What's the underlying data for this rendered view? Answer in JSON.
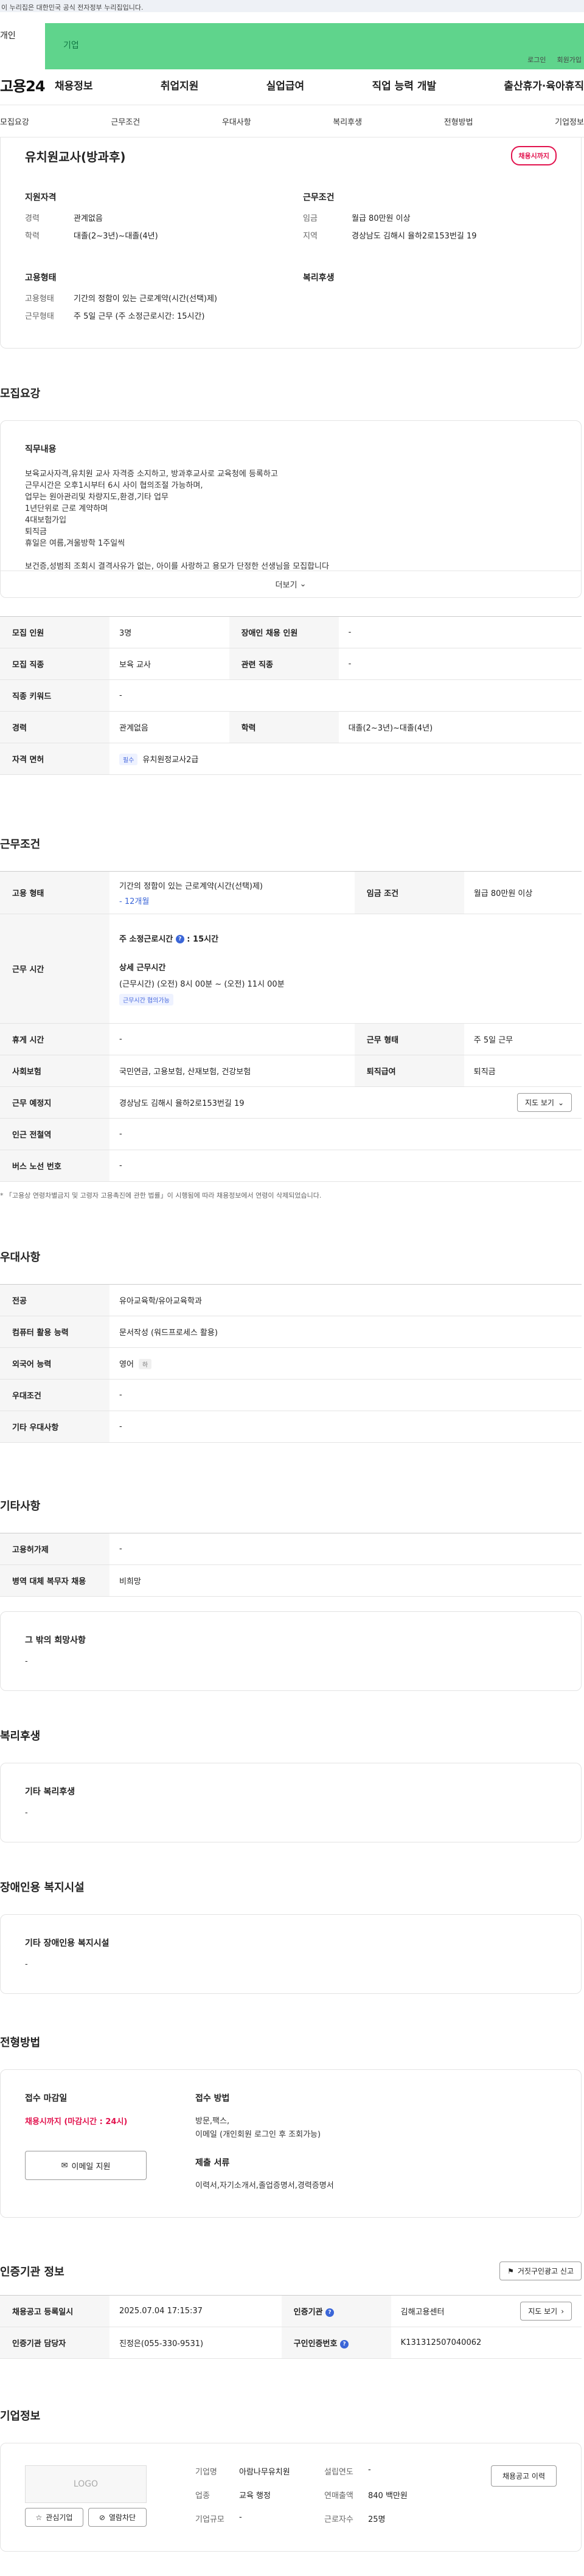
{
  "topbar": {
    "notice": "이 누리집은 대한민국 공식 전자정부 누리집입니다."
  },
  "member_tabs": {
    "personal": "개인",
    "company": "기업"
  },
  "util": {
    "login": "로그인",
    "join": "회원가입"
  },
  "header": {
    "logo": "고용24",
    "gnb": [
      "채용정보",
      "취업지원",
      "실업급여",
      "직업 능력 개발",
      "출산휴가·육아휴직"
    ]
  },
  "lnb": [
    "모집요강",
    "근무조건",
    "우대사항",
    "복리후생",
    "전형방법",
    "기업정보"
  ],
  "job": {
    "title": "유치원교사(방과후)",
    "deadline_badge": "채용시까지",
    "summary": {
      "qual_h": "지원자격",
      "career_k": "경력",
      "career_v": "관계없음",
      "edu_k": "학력",
      "edu_v": "대졸(2~3년)~대졸(4년)",
      "cond_h": "근무조건",
      "wage_k": "임금",
      "wage_v": "월급 80만원 이상",
      "area_k": "지역",
      "area_v": "경상남도 김해시 율하2로153번길 19",
      "emp_h": "고용형태",
      "emptype_k": "고용형태",
      "emptype_v": "기간의 정함이 있는 근로계약(시간(선택)제)",
      "worktype_k": "근무형태",
      "worktype_v": "주 5일 근무 (주 소정근로시간: 15시간)",
      "welfare_h": "복리후생"
    }
  },
  "recruit": {
    "section_title": "모집요강",
    "content_h": "직무내용",
    "content": "보육교사자격,유치원 교사 자격증 소지하고, 방과후교사로 교육청에 등록하고\n근무시간은 오후1시부터 6시 사이 협의조절 가능하며,\n업무는 원아관리및 차량지도,환경,기타 업무\n1년단위로 근로 계약하며\n4대보험가입\n퇴직금\n휴일은 여름,겨울방학 1주일씩\n\n보건증,성범죄 조회시 결격사유가 없는, 아이를 사랑하고 용모가 단정한 선생님을 모집합니다",
    "more": "더보기",
    "table": {
      "count_k": "모집 인원",
      "count_v": "3명",
      "disabled_k": "장애인 채용 인원",
      "disabled_v": "-",
      "job_k": "모집 직종",
      "job_v": "보육 교사",
      "related_k": "관련 직종",
      "related_v": "-",
      "keyword_k": "직종 키워드",
      "keyword_v": "-",
      "career_k": "경력",
      "career_v": "관계없음",
      "edu_k": "학력",
      "edu_v": "대졸(2~3년)~대졸(4년)",
      "license_k": "자격 면허",
      "license_chip": "필수",
      "license_v": "유치원정교사2급"
    }
  },
  "work": {
    "section_title": "근무조건",
    "emptype_k": "고용 형태",
    "emptype_v": "기간의 정함이 있는 근로계약(시간(선택)제)",
    "emptype_sub": "- 12개월",
    "wage_k": "임금 조건",
    "wage_v": "월급 80만원 이상",
    "time_k": "근무 시간",
    "time_weekly_label": "주 소정근로시간",
    "time_weekly_v": "15시간",
    "time_detail_h": "상세 근무시간",
    "time_detail_v": "(근무시간) (오전) 8시 00분 ~ (오전) 11시 00분",
    "time_chip": "근무시간 협의가능",
    "rest_k": "휴게 시간",
    "rest_v": "-",
    "worktype_k": "근무 형태",
    "worktype_v": "주 5일 근무",
    "insurance_k": "사회보험",
    "insurance_v": "국민연금, 고용보험, 산재보험, 건강보험",
    "retire_k": "퇴직급여",
    "retire_v": "퇴직금",
    "place_k": "근무 예정지",
    "place_v": "경상남도 김해시 율하2로153번길 19",
    "map_btn": "지도 보기",
    "subway_k": "인근 전철역",
    "subway_v": "-",
    "bus_k": "버스 노선 번호",
    "bus_v": "-",
    "note": "* 「고용상 연령차별금지 및 고령자 고용촉진에 관한 법률」이 시행됨에 따라 채용정보에서 연령이 삭제되었습니다."
  },
  "prefer": {
    "section_title": "우대사항",
    "major_k": "전공",
    "major_v": "유아교육학/유아교육학과",
    "pc_k": "컴퓨터 활용 능력",
    "pc_v": "문서작성 (워드프로세스 활용)",
    "lang_k": "외국어 능력",
    "lang_v": "영어",
    "lang_chip": "하",
    "cond_k": "우대조건",
    "cond_v": "-",
    "etc_k": "기타 우대사항",
    "etc_v": "-"
  },
  "etc": {
    "section_title": "기타사항",
    "permit_k": "고용허가제",
    "permit_v": "-",
    "military_k": "병역 대체 복무자 채용",
    "military_v": "비희망",
    "wish_h": "그 밖의 희망사항",
    "wish_v": "-"
  },
  "welfare": {
    "section_title": "복리후생",
    "h": "기타 복리후생",
    "v": "-"
  },
  "disability": {
    "section_title": "장애인용 복지시설",
    "h": "기타 장애인용 복지시설",
    "v": "-"
  },
  "apply": {
    "section_title": "전형방법",
    "deadline_h": "접수 마감일",
    "deadline_v": "채용시까지 (마감시간 : 24시)",
    "email_btn": "이메일 지원",
    "method_h": "접수 방법",
    "method_v1": "방문,팩스,",
    "method_v2": "이메일 (개인회원 로그인 후 조회가능)",
    "docs_h": "제출 서류",
    "docs_v": "이력서,자기소개서,졸업증명서,경력증명서"
  },
  "agency": {
    "section_title": "인증기관 정보",
    "false_report_btn": "거짓구인광고 신고",
    "reg_k": "채용공고 등록일시",
    "reg_v": "2025.07.04 17:15:37",
    "org_k": "인증기관",
    "org_v": "김해고용센터",
    "map_btn": "지도 보기",
    "mgr_k": "인증기관 담당자",
    "mgr_v": "진정은(055-330-9531)",
    "no_k": "구인인증번호",
    "no_v": "K131312507040062"
  },
  "company": {
    "section_title": "기업정보",
    "logo_placeholder": "LOGO",
    "interest_btn": "관심기업",
    "block_btn": "열람차단",
    "name_k": "기업명",
    "name_v": "아람나무유치원",
    "year_k": "설립연도",
    "year_v": "-",
    "ind_k": "업종",
    "ind_v": "교육 행정",
    "sales_k": "연매출액",
    "sales_v": "840 백만원",
    "size_k": "기업규모",
    "size_v": "-",
    "staff_k": "근로자수",
    "staff_v": "25명",
    "history_btn": "채용공고 이력"
  },
  "colors": {
    "brand_green": "#5fd48c",
    "accent_red": "#e2134e",
    "accent_blue": "#3b66d8"
  }
}
